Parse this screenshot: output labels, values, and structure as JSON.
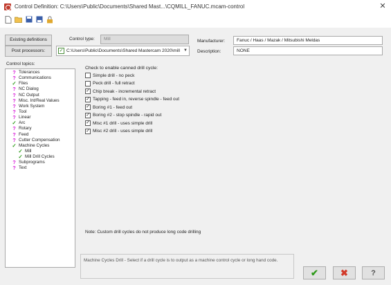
{
  "window": {
    "title": "Control Definition: C:\\Users\\Public\\Documents\\Shared Mast...\\CQMILL_FANUC.mcam-control",
    "close_label": "✕"
  },
  "toolbar": [
    {
      "name": "new-file-icon"
    },
    {
      "name": "open-folder-icon"
    },
    {
      "name": "save-icon"
    },
    {
      "name": "save-as-icon"
    },
    {
      "name": "lock-icon"
    }
  ],
  "buttons": {
    "existing_definitions": "Existing definitions",
    "post_processors": "Post processors:"
  },
  "fields": {
    "control_type_label": "Control type:",
    "control_type_value": "Mill",
    "post_path": "C:\\Users\\Public\\Documents\\Shared Mastercam 2020\\mill",
    "manufacturer_label": "Manufacturer:",
    "manufacturer_value": "Fanuc / Haas / Mazak / Mitsubishi Meldas",
    "description_label": "Description:",
    "description_value": "NONE"
  },
  "tree": {
    "label": "Control topics:",
    "items": [
      {
        "label": "Tolerances",
        "icon": "q",
        "indent": 0
      },
      {
        "label": "Communications",
        "icon": "q",
        "indent": 0
      },
      {
        "label": "Files",
        "icon": "c",
        "indent": 0
      },
      {
        "label": "NC Dialog",
        "icon": "q",
        "indent": 0
      },
      {
        "label": "NC Output",
        "icon": "q",
        "indent": 0
      },
      {
        "label": "Misc. Int/Real Values",
        "icon": "q",
        "indent": 0
      },
      {
        "label": "Work System",
        "icon": "q",
        "indent": 0
      },
      {
        "label": "Tool",
        "icon": "q",
        "indent": 0
      },
      {
        "label": "Linear",
        "icon": "q",
        "indent": 0
      },
      {
        "label": "Arc",
        "icon": "c",
        "indent": 0
      },
      {
        "label": "Rotary",
        "icon": "q",
        "indent": 0
      },
      {
        "label": "Feed",
        "icon": "q",
        "indent": 0
      },
      {
        "label": "Cutter Compensation",
        "icon": "q",
        "indent": 0
      },
      {
        "label": "Machine Cycles",
        "icon": "c",
        "indent": 0
      },
      {
        "label": "Mill",
        "icon": "c",
        "indent": 1
      },
      {
        "label": "Mill Drill Cycles",
        "icon": "c",
        "indent": 1,
        "selected": true
      },
      {
        "label": "Subprograms",
        "icon": "q",
        "indent": 0
      },
      {
        "label": "Text",
        "icon": "q",
        "indent": 0
      }
    ]
  },
  "options": {
    "heading": "Check to enable canned drill cycle:",
    "items": [
      {
        "label": "Simple drill - no peck",
        "checked": false
      },
      {
        "label": "Peck drill - full retract",
        "checked": false
      },
      {
        "label": "Chip break - incremental retract",
        "checked": true
      },
      {
        "label": "Tapping - feed in, reverse spindle - feed out",
        "checked": true
      },
      {
        "label": "Boring #1 - feed out",
        "checked": true
      },
      {
        "label": "Boring #2 - stop spindle - rapid out",
        "checked": true
      },
      {
        "label": "Misc #1 drill - uses simple drill",
        "checked": true
      },
      {
        "label": "Misc #2 drill - uses simple drill",
        "checked": true
      }
    ],
    "note": "Note: Custom drill cycles do not produce long code drilling"
  },
  "help_text": "Machine Cycles Drill - Select if a drill cycle is to output as a machine control cycle or long hand code.",
  "actions": {
    "ok": "✔",
    "cancel": "✖",
    "help": "?"
  },
  "colors": {
    "question": "#d81bd8",
    "check": "#2e9a1a",
    "cancel_red": "#d23a2a"
  }
}
